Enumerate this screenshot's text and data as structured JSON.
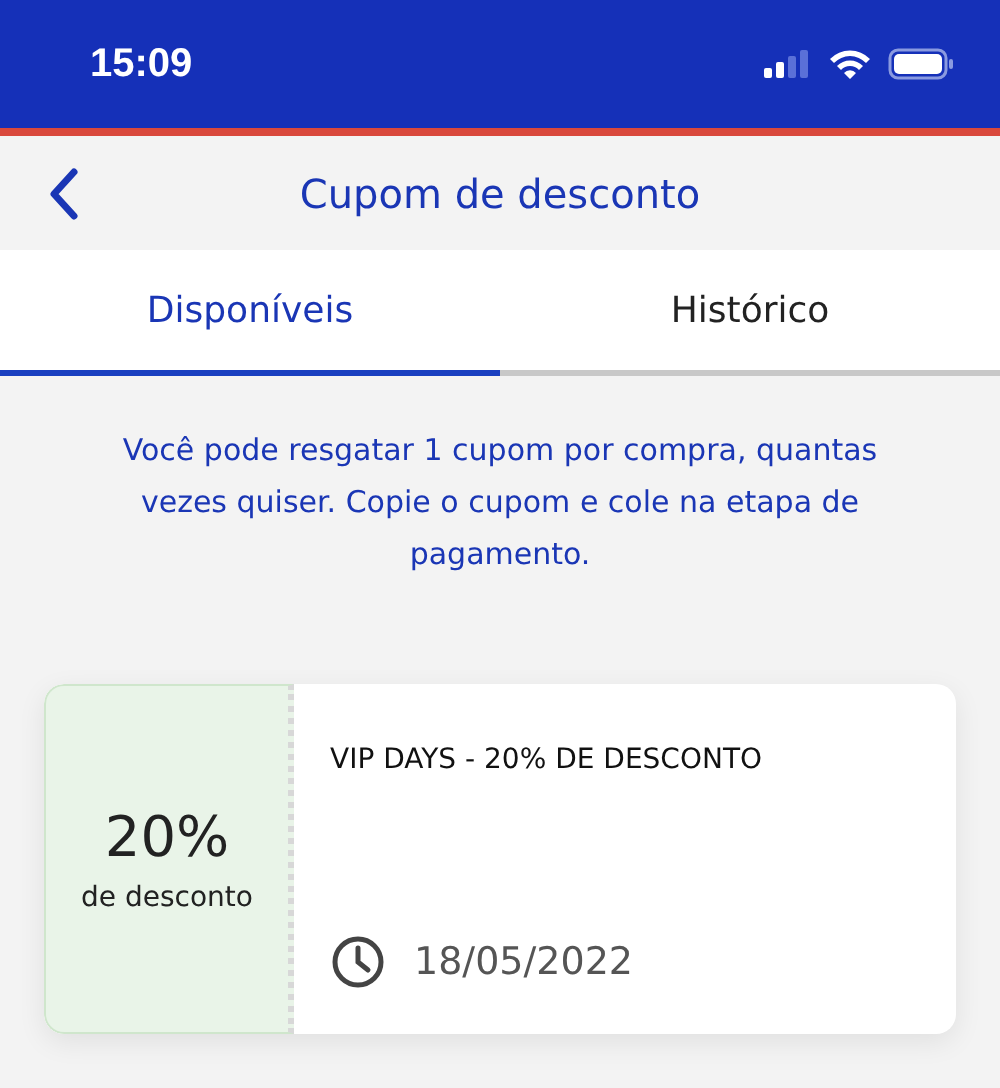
{
  "status_bar": {
    "time": "15:09"
  },
  "header": {
    "title": "Cupom de desconto"
  },
  "tabs": [
    {
      "label": "Disponíveis",
      "selected": true
    },
    {
      "label": "Histórico",
      "selected": false
    }
  ],
  "info": "Você pode resgatar 1 cupom por compra, quantas vezes quiser. Copie o cupom e cole na etapa de pagamento.",
  "coupons": [
    {
      "percent": "20%",
      "percent_caption": "de desconto",
      "title": "VIP DAYS - 20% DE DESCONTO",
      "date": "18/05/2022"
    }
  ]
}
